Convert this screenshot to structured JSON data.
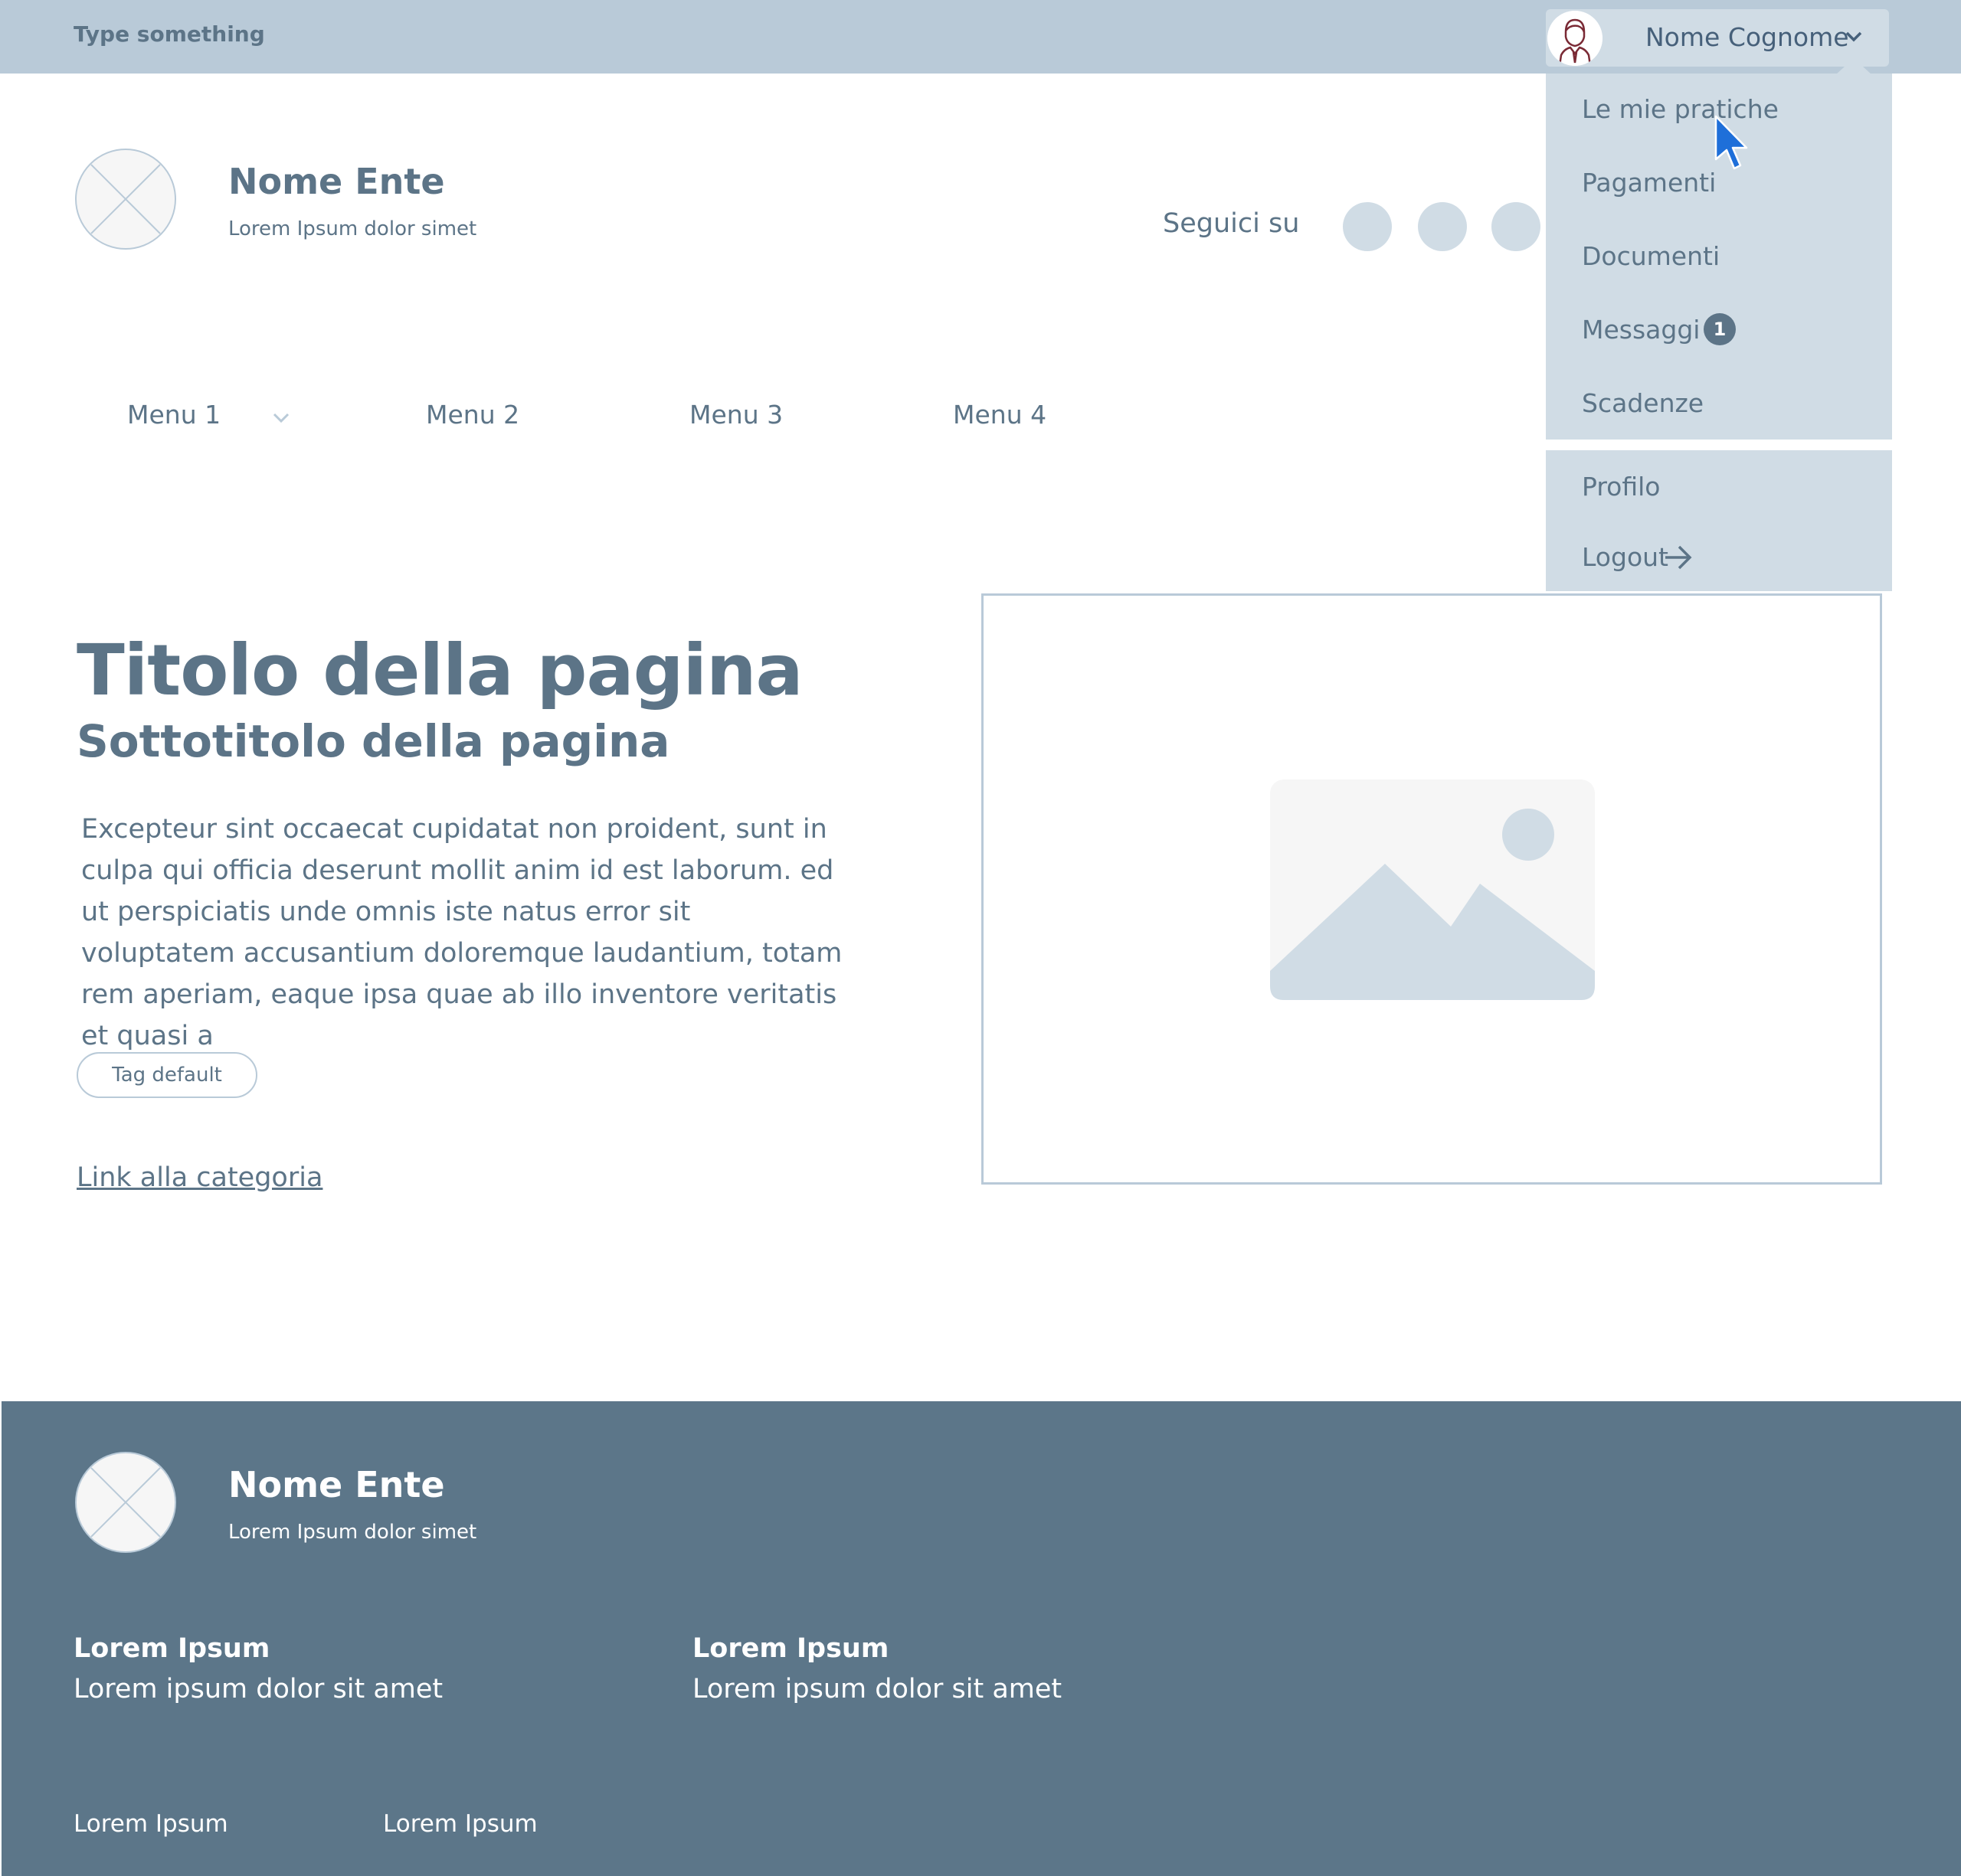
{
  "topbar": {
    "search_text": "Type something",
    "user_name": "Nome Cognome"
  },
  "header": {
    "title": "Nome Ente",
    "subtitle": "Lorem Ipsum dolor simet",
    "follow_label": "Seguici su"
  },
  "nav": {
    "items": [
      "Menu 1",
      "Menu 2",
      "Menu 3",
      "Menu 4"
    ]
  },
  "dropdown": {
    "items": [
      "Le mie pratiche",
      "Pagamenti",
      "Documenti",
      "Messaggi",
      "Scadenze"
    ],
    "messages_badge": "1",
    "profile": "Profilo",
    "logout": "Logout"
  },
  "main": {
    "title": "Titolo della pagina",
    "subtitle": "Sottotitolo della pagina",
    "body": "Excepteur sint occaecat cupidatat non proident, sunt in culpa qui officia deserunt mollit anim id est laborum. ed ut perspiciatis unde omnis iste natus error sit voluptatem accusantium doloremque laudantium, totam rem aperiam, eaque ipsa quae ab illo inventore veritatis et quasi a",
    "tag": "Tag default",
    "category_link": "Link alla categoria"
  },
  "footer": {
    "title": "Nome Ente",
    "subtitle": "Lorem Ipsum dolor simet",
    "columns": [
      {
        "heading": "Lorem Ipsum",
        "text": "Lorem ipsum dolor sit amet"
      },
      {
        "heading": "Lorem Ipsum",
        "text": "Lorem ipsum dolor sit amet"
      }
    ],
    "bottom_links": [
      "Lorem Ipsum",
      "Lorem Ipsum"
    ]
  },
  "colors": {
    "topbar": "#b9cad8",
    "dropdown": "#d0dce5",
    "text": "#5c7487",
    "footer": "#5c7689"
  }
}
